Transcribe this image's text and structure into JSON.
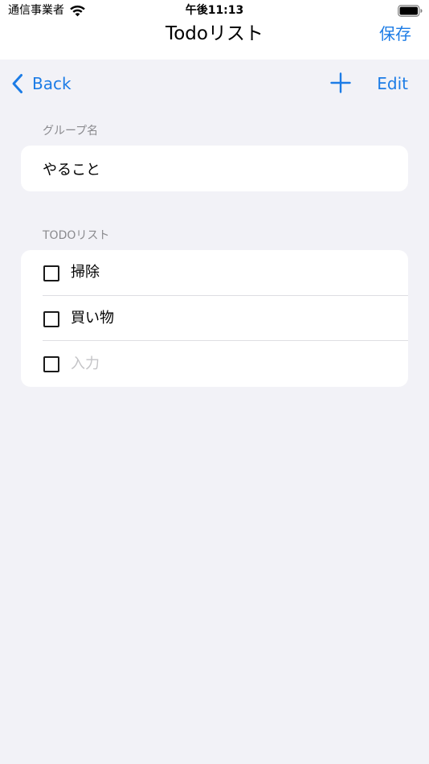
{
  "status_bar": {
    "carrier": "通信事業者",
    "time": "午後11:13",
    "wifi_icon": "wifi-icon",
    "battery_icon": "battery-full-icon"
  },
  "nav": {
    "title": "Todoリスト",
    "save_label": "保存"
  },
  "toolbar": {
    "back_label": "Back",
    "back_icon": "chevron-left-icon",
    "add_icon": "plus-icon",
    "edit_label": "Edit"
  },
  "group_section": {
    "header": "グループ名",
    "value": "やること"
  },
  "todo_section": {
    "header": "TODOリスト",
    "items": [
      {
        "label": "掃除",
        "checked": false
      },
      {
        "label": "買い物",
        "checked": false
      }
    ],
    "new_item": {
      "placeholder": "入力",
      "value": "",
      "checked": false
    }
  },
  "colors": {
    "accent": "#1C7CE6",
    "background": "#F2F2F7",
    "card": "#FFFFFF",
    "section_header": "#8A8A8E",
    "placeholder": "#C4C4C7",
    "separator": "#DEDEE2"
  }
}
